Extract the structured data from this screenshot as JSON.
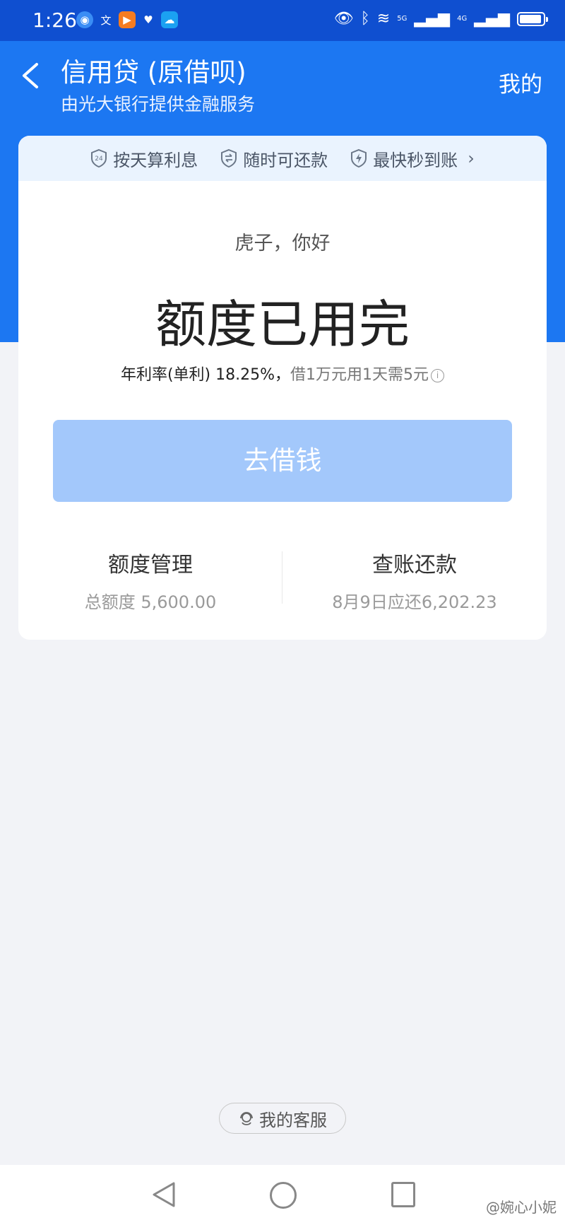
{
  "status_bar": {
    "time": "1:26",
    "network_labels": [
      "5G",
      "4G"
    ]
  },
  "header": {
    "back_icon": "chevron-left-icon",
    "title": "信用贷 (原借呗)",
    "subtitle": "由光大银行提供金融服务",
    "mine_label": "我的"
  },
  "features": {
    "items": [
      {
        "icon": "24h-shield-icon",
        "label": "按天算利息"
      },
      {
        "icon": "exchange-shield-icon",
        "label": "随时可还款"
      },
      {
        "icon": "lightning-shield-icon",
        "label": "最快秒到账"
      }
    ]
  },
  "account": {
    "greeting": "虎子，你好",
    "status": "额度已用完",
    "rate_label": "年利率(单利) 18.25%，",
    "rate_note": "借1万元用1天需5元",
    "borrow_button": "去借钱"
  },
  "quick": {
    "left_title": "额度管理",
    "left_sub": "总额度 5,600.00",
    "right_title": "查账还款",
    "right_sub": "8月9日应还6,202.23"
  },
  "service": {
    "label": "我的客服"
  },
  "watermark": "@婉心小妮",
  "colors": {
    "brand_blue": "#1c77f2",
    "status_bar": "#0f4fd0",
    "button_disabled": "#a3c8fb",
    "feature_bg": "#eaf3fe",
    "page_bg": "#f2f3f7"
  }
}
